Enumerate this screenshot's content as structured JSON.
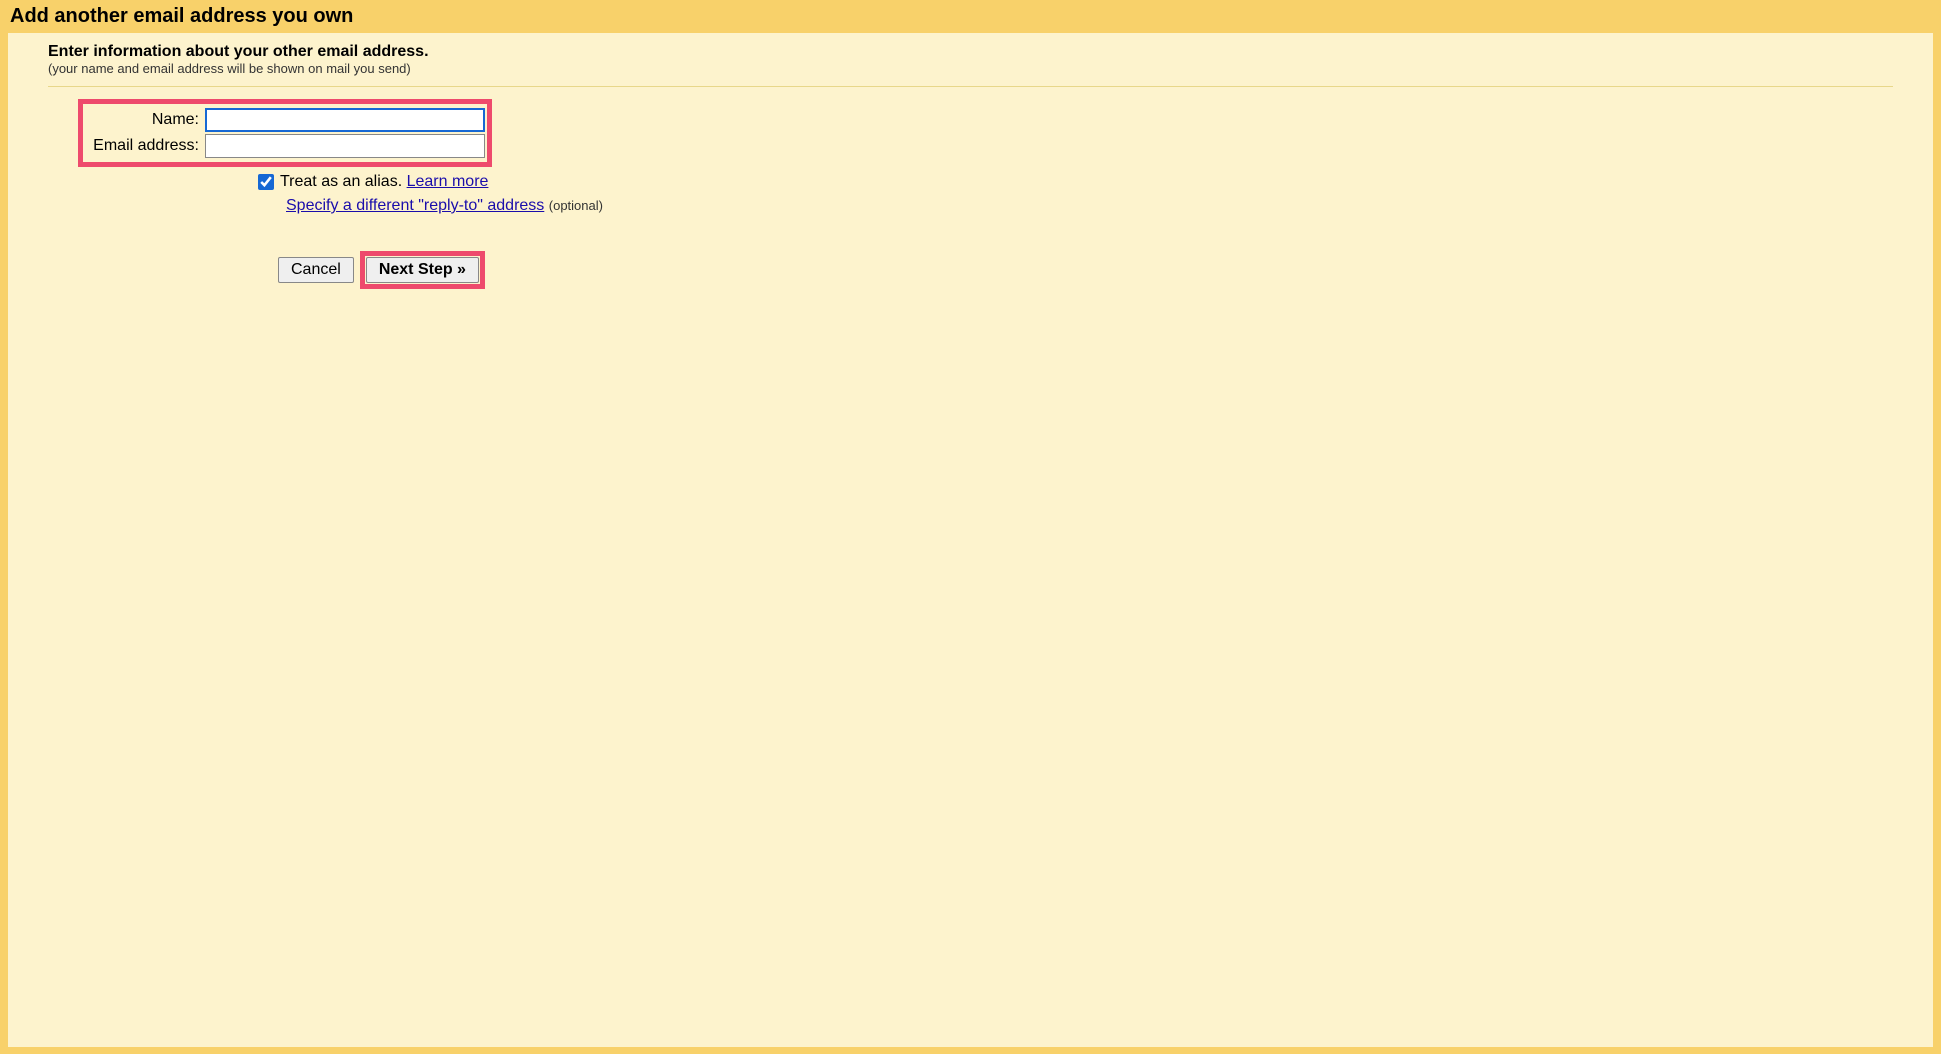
{
  "header": {
    "title": "Add another email address you own"
  },
  "instruction": {
    "main": "Enter information about your other email address.",
    "sub": "(your name and email address will be shown on mail you send)"
  },
  "form": {
    "name_label": "Name:",
    "name_value": "",
    "email_label": "Email address:",
    "email_value": ""
  },
  "options": {
    "alias_checked": true,
    "alias_text": "Treat as an alias.",
    "learn_more": "Learn more",
    "reply_to_link": "Specify a different \"reply-to\" address",
    "optional": "(optional)"
  },
  "buttons": {
    "cancel": "Cancel",
    "next": "Next Step »"
  }
}
